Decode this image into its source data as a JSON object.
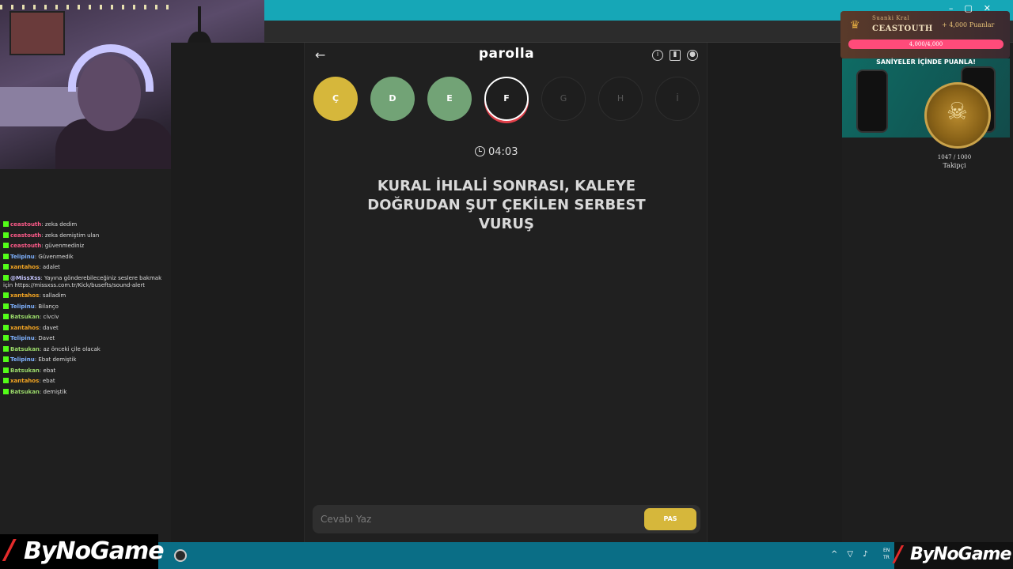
{
  "game": {
    "title": "parolla",
    "back_icon": "arrow-left-icon",
    "letters": [
      {
        "char": "Ç",
        "state": "correct-yellow"
      },
      {
        "char": "D",
        "state": "correct-green"
      },
      {
        "char": "E",
        "state": "correct-green"
      },
      {
        "char": "F",
        "state": "active"
      },
      {
        "char": "G",
        "state": "pending"
      },
      {
        "char": "H",
        "state": "pending"
      },
      {
        "char": "İ",
        "state": "pending"
      }
    ],
    "timer": "04:03",
    "question": "KURAL İHLALİ SONRASI, KALEYE DOĞRUDAN ŞUT ÇEKİLEN SERBEST VURUŞ",
    "answer_placeholder": "Cevabı Yaz",
    "pass_label": "PAS",
    "colors": {
      "yellow": "#d6b73b",
      "green": "#72a376",
      "active_ring": "#e0404a"
    }
  },
  "chat": [
    {
      "user": "ceastouth",
      "text": "zeka dedim",
      "color": "#ff5b8a"
    },
    {
      "user": "ceastouth",
      "text": "zeka demiştim ulan",
      "color": "#ff5b8a"
    },
    {
      "user": "ceastouth",
      "text": "güvenmediniz",
      "color": "#ff5b8a"
    },
    {
      "user": "Telipinu",
      "text": "Güvenmedik",
      "color": "#7fb2ff"
    },
    {
      "user": "xantahos",
      "text": "adalet",
      "color": "#f5a623"
    },
    {
      "user": "@MissXss",
      "text": "Yayına gönderebileceğiniz seslere bakmak için https://missxss.com.tr/Kick/busefts/sound-alert",
      "color": "#c6c6ff"
    },
    {
      "user": "xantahos",
      "text": "salladim",
      "color": "#f5a623"
    },
    {
      "user": "Telipinu",
      "text": "Bilanço",
      "color": "#7fb2ff"
    },
    {
      "user": "Batsukan",
      "text": "civciv",
      "color": "#9ad86a"
    },
    {
      "user": "xantahos",
      "text": "davet",
      "color": "#f5a623"
    },
    {
      "user": "Telipinu",
      "text": "Davet",
      "color": "#7fb2ff"
    },
    {
      "user": "Batsukan",
      "text": "az önceki çile olacak",
      "color": "#9ad86a"
    },
    {
      "user": "Telipinu",
      "text": "Ebat demiştik",
      "color": "#7fb2ff"
    },
    {
      "user": "Batsukan",
      "text": "ebat",
      "color": "#9ad86a"
    },
    {
      "user": "xantahos",
      "text": "ebat",
      "color": "#f5a623"
    },
    {
      "user": "Batsukan",
      "text": "demiştik",
      "color": "#9ad86a"
    }
  ],
  "overlay": {
    "king_label": "Suanki Kral",
    "king_name": "CEASTOUTH",
    "king_points": "+ 4,000 Puanlar",
    "king_bar": "4,000/4,000",
    "ad_title": "SANİYELER İÇİNDE PUANLA!",
    "follower_count": "1047 / 1000",
    "follower_label": "Takipçi"
  },
  "branding": {
    "logo": "ByNoGame"
  },
  "taskbar": {
    "lang": "EN\nTR"
  }
}
